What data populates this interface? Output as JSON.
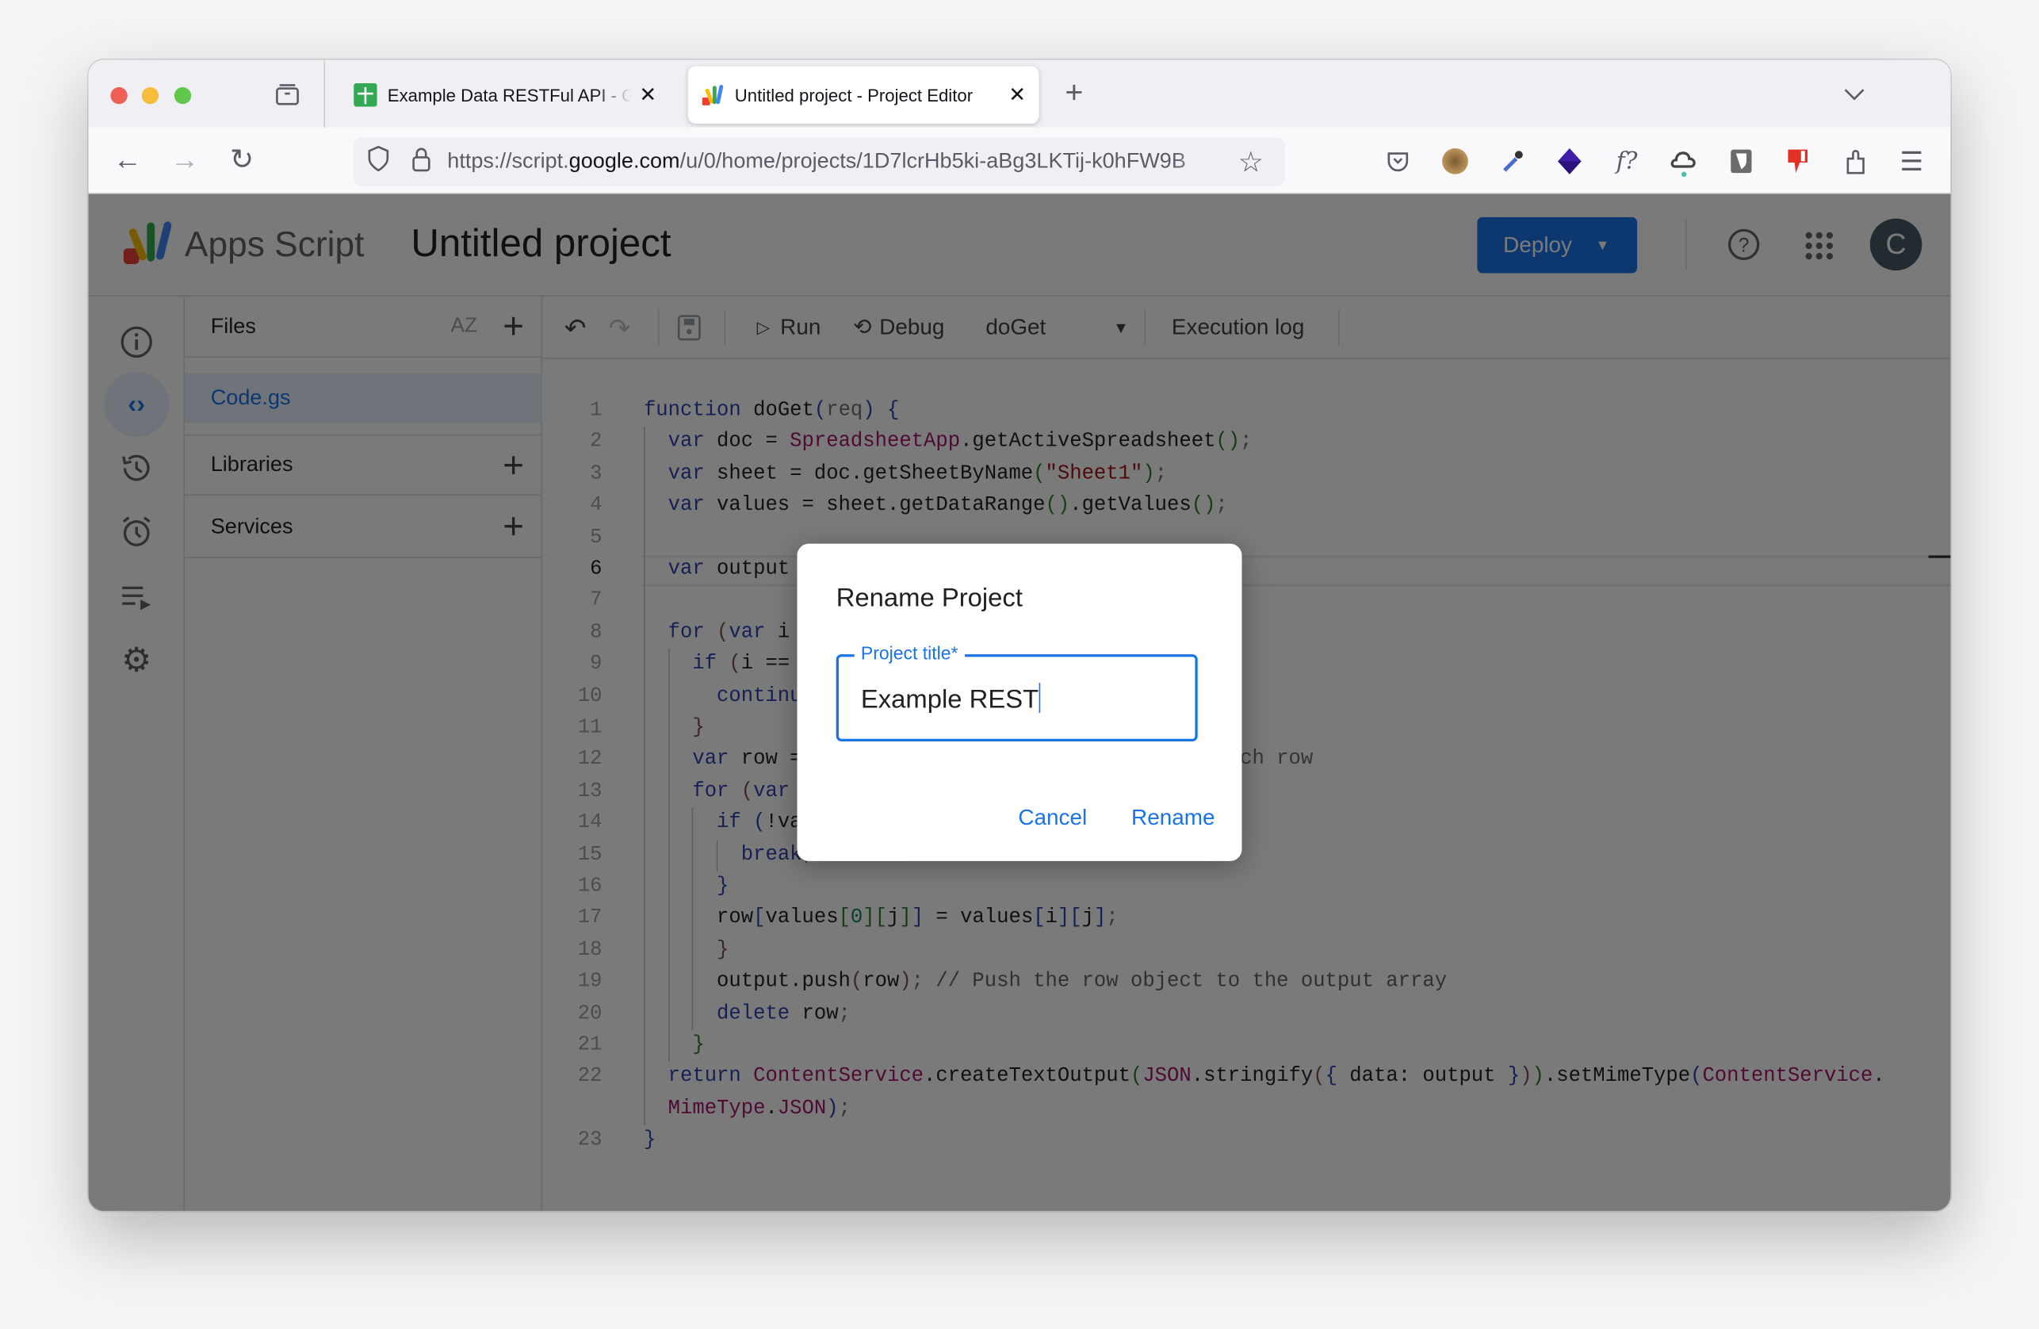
{
  "browser": {
    "tabs": [
      {
        "label": "Example Data RESTFul API - Google Sheets",
        "icon": "google-sheets-icon",
        "active": false
      },
      {
        "label": "Untitled project - Project Editor",
        "icon": "apps-script-icon",
        "active": true
      }
    ],
    "url_prefix": "https://script.",
    "url_domain": "google.com",
    "url_path": "/u/0/home/projects/1D7lcrHb5ki-aBg3LKTij-k0hFW9B"
  },
  "app": {
    "product": "Apps Script",
    "project_title": "Untitled project",
    "deploy_label": "Deploy",
    "avatar_letter": "C",
    "accent": "#1a73e8"
  },
  "files_panel": {
    "files_label": "Files",
    "sort_label": "AZ",
    "files": [
      "Code.gs"
    ],
    "libraries_label": "Libraries",
    "services_label": "Services"
  },
  "toolbar": {
    "run_label": "Run",
    "debug_label": "Debug",
    "function_select": "doGet",
    "execution_log_label": "Execution log"
  },
  "code": {
    "current_line": 6,
    "lines": [
      {
        "n": "1",
        "i": 0,
        "t": [
          [
            "kw",
            "function"
          ],
          [
            "id",
            " doGet"
          ],
          [
            "pb",
            "("
          ],
          [
            "dim",
            "req"
          ],
          [
            "pb",
            ")"
          ],
          [
            "id",
            " "
          ],
          [
            "pb",
            "{"
          ]
        ]
      },
      {
        "n": "2",
        "i": 2,
        "t": [
          [
            "kw",
            "var"
          ],
          [
            "id",
            " doc = "
          ],
          [
            "cls",
            "SpreadsheetApp"
          ],
          [
            "id",
            ".getActiveSpreadsheet"
          ],
          [
            "pg",
            "()"
          ],
          [
            "dim",
            ";"
          ]
        ]
      },
      {
        "n": "3",
        "i": 2,
        "t": [
          [
            "kw",
            "var"
          ],
          [
            "id",
            " sheet = doc.getSheetByName"
          ],
          [
            "pg",
            "("
          ],
          [
            "str",
            "\"Sheet1\""
          ],
          [
            "pg",
            ")"
          ],
          [
            "dim",
            ";"
          ]
        ]
      },
      {
        "n": "4",
        "i": 2,
        "t": [
          [
            "kw",
            "var"
          ],
          [
            "id",
            " values = sheet.getDataRange"
          ],
          [
            "pg",
            "()"
          ],
          [
            "id",
            ".getValues"
          ],
          [
            "pg",
            "()"
          ],
          [
            "dim",
            ";"
          ]
        ]
      },
      {
        "n": "5",
        "i": 0,
        "t": []
      },
      {
        "n": "6",
        "i": 2,
        "t": [
          [
            "kw",
            "var"
          ],
          [
            "id",
            " output"
          ]
        ]
      },
      {
        "n": "7",
        "i": 0,
        "t": []
      },
      {
        "n": "8",
        "i": 2,
        "t": [
          [
            "kw",
            "for"
          ],
          [
            "id",
            " "
          ],
          [
            "pr",
            "("
          ],
          [
            "kw",
            "var"
          ],
          [
            "id",
            " i"
          ]
        ]
      },
      {
        "n": "9",
        "i": 4,
        "t": [
          [
            "kw",
            "if"
          ],
          [
            "id",
            " "
          ],
          [
            "pr",
            "("
          ],
          [
            "id",
            "i =="
          ]
        ]
      },
      {
        "n": "10",
        "i": 6,
        "t": [
          [
            "kw",
            "continu"
          ]
        ]
      },
      {
        "n": "11",
        "i": 4,
        "t": [
          [
            "pr",
            "}"
          ]
        ]
      },
      {
        "n": "12",
        "i": 4,
        "t": [
          [
            "kw",
            "var"
          ],
          [
            "id",
            " row =                                  "
          ],
          [
            "dim",
            "each row"
          ]
        ]
      },
      {
        "n": "13",
        "i": 4,
        "t": [
          [
            "kw",
            "for"
          ],
          [
            "id",
            " "
          ],
          [
            "pr",
            "("
          ],
          [
            "kw",
            "var"
          ]
        ]
      },
      {
        "n": "14",
        "i": 6,
        "t": [
          [
            "kw",
            "if"
          ],
          [
            "id",
            " "
          ],
          [
            "pb",
            "("
          ],
          [
            "id",
            "!va"
          ]
        ]
      },
      {
        "n": "15",
        "i": 8,
        "t": [
          [
            "kw",
            "break"
          ],
          [
            "dim",
            ";"
          ]
        ]
      },
      {
        "n": "16",
        "i": 6,
        "t": [
          [
            "pb",
            "}"
          ]
        ]
      },
      {
        "n": "17",
        "i": 6,
        "t": [
          [
            "id",
            "row"
          ],
          [
            "pb",
            "["
          ],
          [
            "id",
            "values"
          ],
          [
            "pg",
            "["
          ],
          [
            "num",
            "0"
          ],
          [
            "pg",
            "]["
          ],
          [
            "id",
            "j"
          ],
          [
            "pg",
            "]"
          ],
          [
            "pb",
            "]"
          ],
          [
            "id",
            " = values"
          ],
          [
            "pb",
            "["
          ],
          [
            "id",
            "i"
          ],
          [
            "pb",
            "]["
          ],
          [
            "id",
            "j"
          ],
          [
            "pb",
            "]"
          ],
          [
            "dim",
            ";"
          ]
        ]
      },
      {
        "n": "18",
        "i": 6,
        "t": [
          [
            "pr",
            "}"
          ]
        ]
      },
      {
        "n": "19",
        "i": 6,
        "t": [
          [
            "id",
            "output.push"
          ],
          [
            "pr",
            "("
          ],
          [
            "id",
            "row"
          ],
          [
            "pr",
            ")"
          ],
          [
            "dim",
            "; "
          ],
          [
            "cm",
            "// Push the row object to the output array"
          ]
        ]
      },
      {
        "n": "20",
        "i": 6,
        "t": [
          [
            "kw",
            "delete"
          ],
          [
            "id",
            " row"
          ],
          [
            "dim",
            ";"
          ]
        ]
      },
      {
        "n": "21",
        "i": 4,
        "t": [
          [
            "pg",
            "}"
          ]
        ]
      },
      {
        "n": "22",
        "i": 2,
        "t": [
          [
            "kw",
            "return"
          ],
          [
            "id",
            " "
          ],
          [
            "cls",
            "ContentService"
          ],
          [
            "id",
            ".createTextOutput"
          ],
          [
            "pg",
            "("
          ],
          [
            "cls",
            "JSON"
          ],
          [
            "id",
            ".stringify"
          ],
          [
            "pr",
            "("
          ],
          [
            "pb",
            "{"
          ],
          [
            "id",
            " data: output "
          ],
          [
            "pb",
            "}"
          ],
          [
            "pr",
            ")"
          ],
          [
            "pg",
            ")"
          ],
          [
            "id",
            ".setMimeType"
          ],
          [
            "pb",
            "("
          ],
          [
            "cls",
            "ContentService"
          ],
          [
            "id",
            "."
          ]
        ]
      },
      {
        "n": "",
        "i": 2,
        "t": [
          [
            "cls",
            "MimeType"
          ],
          [
            "id",
            "."
          ],
          [
            "cls",
            "JSON"
          ],
          [
            "pb",
            ")"
          ],
          [
            "dim",
            ";"
          ]
        ]
      },
      {
        "n": "23",
        "i": 0,
        "t": [
          [
            "pb",
            "}"
          ]
        ]
      }
    ]
  },
  "dialog": {
    "title": "Rename Project",
    "field_label": "Project title*",
    "field_value": "Example REST",
    "cancel_label": "Cancel",
    "rename_label": "Rename"
  }
}
